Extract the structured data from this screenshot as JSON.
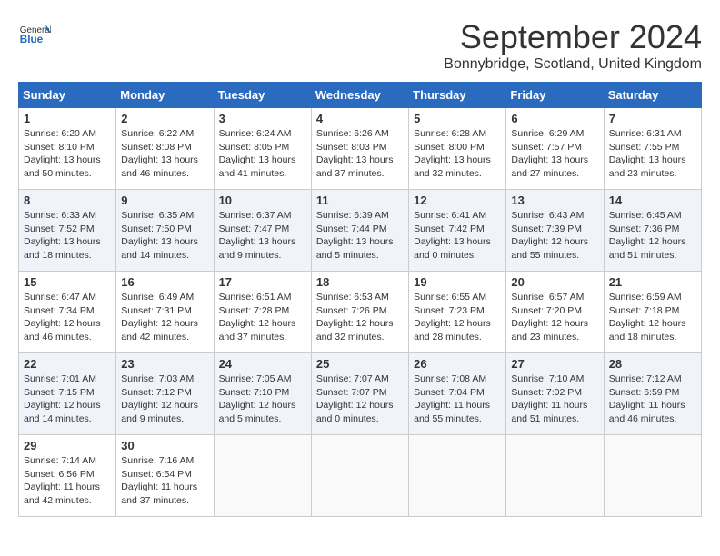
{
  "header": {
    "logo": {
      "general": "General",
      "blue": "Blue"
    },
    "title": "September 2024",
    "location": "Bonnybridge, Scotland, United Kingdom"
  },
  "weekdays": [
    "Sunday",
    "Monday",
    "Tuesday",
    "Wednesday",
    "Thursday",
    "Friday",
    "Saturday"
  ],
  "weeks": [
    [
      {
        "day": "1",
        "sunrise": "6:20 AM",
        "sunset": "8:10 PM",
        "daylight": "13 hours and 50 minutes."
      },
      {
        "day": "2",
        "sunrise": "6:22 AM",
        "sunset": "8:08 PM",
        "daylight": "13 hours and 46 minutes."
      },
      {
        "day": "3",
        "sunrise": "6:24 AM",
        "sunset": "8:05 PM",
        "daylight": "13 hours and 41 minutes."
      },
      {
        "day": "4",
        "sunrise": "6:26 AM",
        "sunset": "8:03 PM",
        "daylight": "13 hours and 37 minutes."
      },
      {
        "day": "5",
        "sunrise": "6:28 AM",
        "sunset": "8:00 PM",
        "daylight": "13 hours and 32 minutes."
      },
      {
        "day": "6",
        "sunrise": "6:29 AM",
        "sunset": "7:57 PM",
        "daylight": "13 hours and 27 minutes."
      },
      {
        "day": "7",
        "sunrise": "6:31 AM",
        "sunset": "7:55 PM",
        "daylight": "13 hours and 23 minutes."
      }
    ],
    [
      {
        "day": "8",
        "sunrise": "6:33 AM",
        "sunset": "7:52 PM",
        "daylight": "13 hours and 18 minutes."
      },
      {
        "day": "9",
        "sunrise": "6:35 AM",
        "sunset": "7:50 PM",
        "daylight": "13 hours and 14 minutes."
      },
      {
        "day": "10",
        "sunrise": "6:37 AM",
        "sunset": "7:47 PM",
        "daylight": "13 hours and 9 minutes."
      },
      {
        "day": "11",
        "sunrise": "6:39 AM",
        "sunset": "7:44 PM",
        "daylight": "13 hours and 5 minutes."
      },
      {
        "day": "12",
        "sunrise": "6:41 AM",
        "sunset": "7:42 PM",
        "daylight": "13 hours and 0 minutes."
      },
      {
        "day": "13",
        "sunrise": "6:43 AM",
        "sunset": "7:39 PM",
        "daylight": "12 hours and 55 minutes."
      },
      {
        "day": "14",
        "sunrise": "6:45 AM",
        "sunset": "7:36 PM",
        "daylight": "12 hours and 51 minutes."
      }
    ],
    [
      {
        "day": "15",
        "sunrise": "6:47 AM",
        "sunset": "7:34 PM",
        "daylight": "12 hours and 46 minutes."
      },
      {
        "day": "16",
        "sunrise": "6:49 AM",
        "sunset": "7:31 PM",
        "daylight": "12 hours and 42 minutes."
      },
      {
        "day": "17",
        "sunrise": "6:51 AM",
        "sunset": "7:28 PM",
        "daylight": "12 hours and 37 minutes."
      },
      {
        "day": "18",
        "sunrise": "6:53 AM",
        "sunset": "7:26 PM",
        "daylight": "12 hours and 32 minutes."
      },
      {
        "day": "19",
        "sunrise": "6:55 AM",
        "sunset": "7:23 PM",
        "daylight": "12 hours and 28 minutes."
      },
      {
        "day": "20",
        "sunrise": "6:57 AM",
        "sunset": "7:20 PM",
        "daylight": "12 hours and 23 minutes."
      },
      {
        "day": "21",
        "sunrise": "6:59 AM",
        "sunset": "7:18 PM",
        "daylight": "12 hours and 18 minutes."
      }
    ],
    [
      {
        "day": "22",
        "sunrise": "7:01 AM",
        "sunset": "7:15 PM",
        "daylight": "12 hours and 14 minutes."
      },
      {
        "day": "23",
        "sunrise": "7:03 AM",
        "sunset": "7:12 PM",
        "daylight": "12 hours and 9 minutes."
      },
      {
        "day": "24",
        "sunrise": "7:05 AM",
        "sunset": "7:10 PM",
        "daylight": "12 hours and 5 minutes."
      },
      {
        "day": "25",
        "sunrise": "7:07 AM",
        "sunset": "7:07 PM",
        "daylight": "12 hours and 0 minutes."
      },
      {
        "day": "26",
        "sunrise": "7:08 AM",
        "sunset": "7:04 PM",
        "daylight": "11 hours and 55 minutes."
      },
      {
        "day": "27",
        "sunrise": "7:10 AM",
        "sunset": "7:02 PM",
        "daylight": "11 hours and 51 minutes."
      },
      {
        "day": "28",
        "sunrise": "7:12 AM",
        "sunset": "6:59 PM",
        "daylight": "11 hours and 46 minutes."
      }
    ],
    [
      {
        "day": "29",
        "sunrise": "7:14 AM",
        "sunset": "6:56 PM",
        "daylight": "11 hours and 42 minutes."
      },
      {
        "day": "30",
        "sunrise": "7:16 AM",
        "sunset": "6:54 PM",
        "daylight": "11 hours and 37 minutes."
      },
      null,
      null,
      null,
      null,
      null
    ]
  ]
}
